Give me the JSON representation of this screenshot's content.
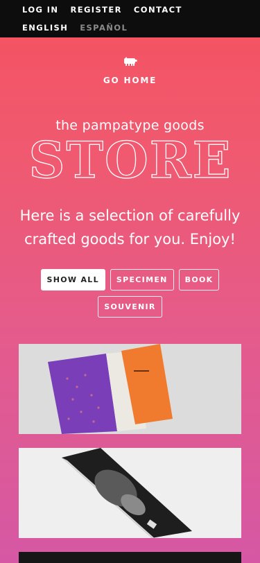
{
  "nav": {
    "primary": [
      "LOG IN",
      "REGISTER",
      "CONTACT"
    ],
    "languages": [
      "ENGLISH",
      "ESPAÑOL"
    ]
  },
  "home": {
    "icon": "pig-logo-icon",
    "label": "GO HOME"
  },
  "store": {
    "subtitle": "the pampatype goods",
    "title": "STORE"
  },
  "tagline": "Here is a selection of carefully crafted goods for you. Enjoy!",
  "filters": [
    {
      "label": "SHOW ALL",
      "active": true
    },
    {
      "label": "SPECIMEN",
      "active": false
    },
    {
      "label": "BOOK",
      "active": false
    },
    {
      "label": "SOUVENIR",
      "active": false
    }
  ],
  "products": [
    {
      "kind": "specimen-book-photo"
    },
    {
      "kind": "book-photo"
    },
    {
      "kind": "product-photo"
    }
  ],
  "colors": {
    "topbar": "#0d0d0d",
    "gradient_top": "#f5525f",
    "gradient_bottom": "#d658a4"
  }
}
